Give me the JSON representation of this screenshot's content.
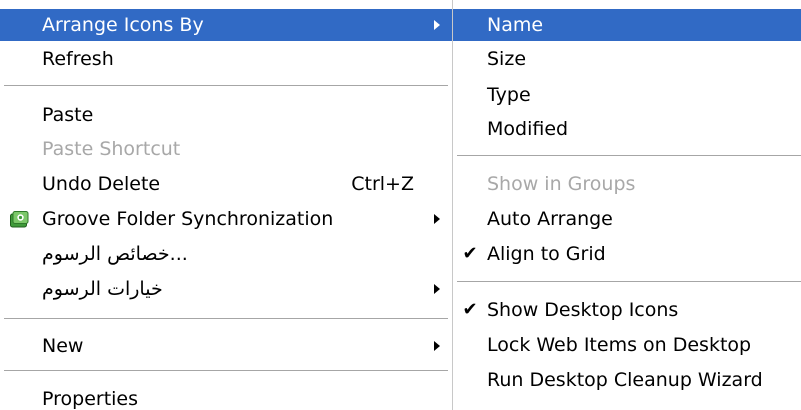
{
  "context_menu": {
    "items": [
      {
        "label": "Arrange Icons By"
      },
      {
        "label": "Refresh"
      },
      {
        "label": "Paste"
      },
      {
        "label": "Paste Shortcut"
      },
      {
        "label": "Undo Delete",
        "shortcut": "Ctrl+Z"
      },
      {
        "label": "Groove Folder Synchronization"
      },
      {
        "label": "...خصائص الرسوم"
      },
      {
        "label": "خيارات الرسوم"
      },
      {
        "label": "New"
      },
      {
        "label": "Properties"
      }
    ]
  },
  "submenu": {
    "items": [
      {
        "label": "Name"
      },
      {
        "label": "Size"
      },
      {
        "label": "Type"
      },
      {
        "label": "Modified"
      },
      {
        "label": "Show in Groups"
      },
      {
        "label": "Auto Arrange"
      },
      {
        "label": "Align to Grid",
        "checked": true
      },
      {
        "label": "Show Desktop Icons",
        "checked": true
      },
      {
        "label": "Lock Web Items on Desktop"
      },
      {
        "label": "Run Desktop Cleanup Wizard"
      }
    ]
  },
  "icons": {
    "check": "✔",
    "groove": "groove-folder-sync-icon"
  },
  "colors": {
    "highlight": "#316ac5",
    "disabled_text": "#a8a8a8",
    "separator": "#a6a6a6"
  }
}
